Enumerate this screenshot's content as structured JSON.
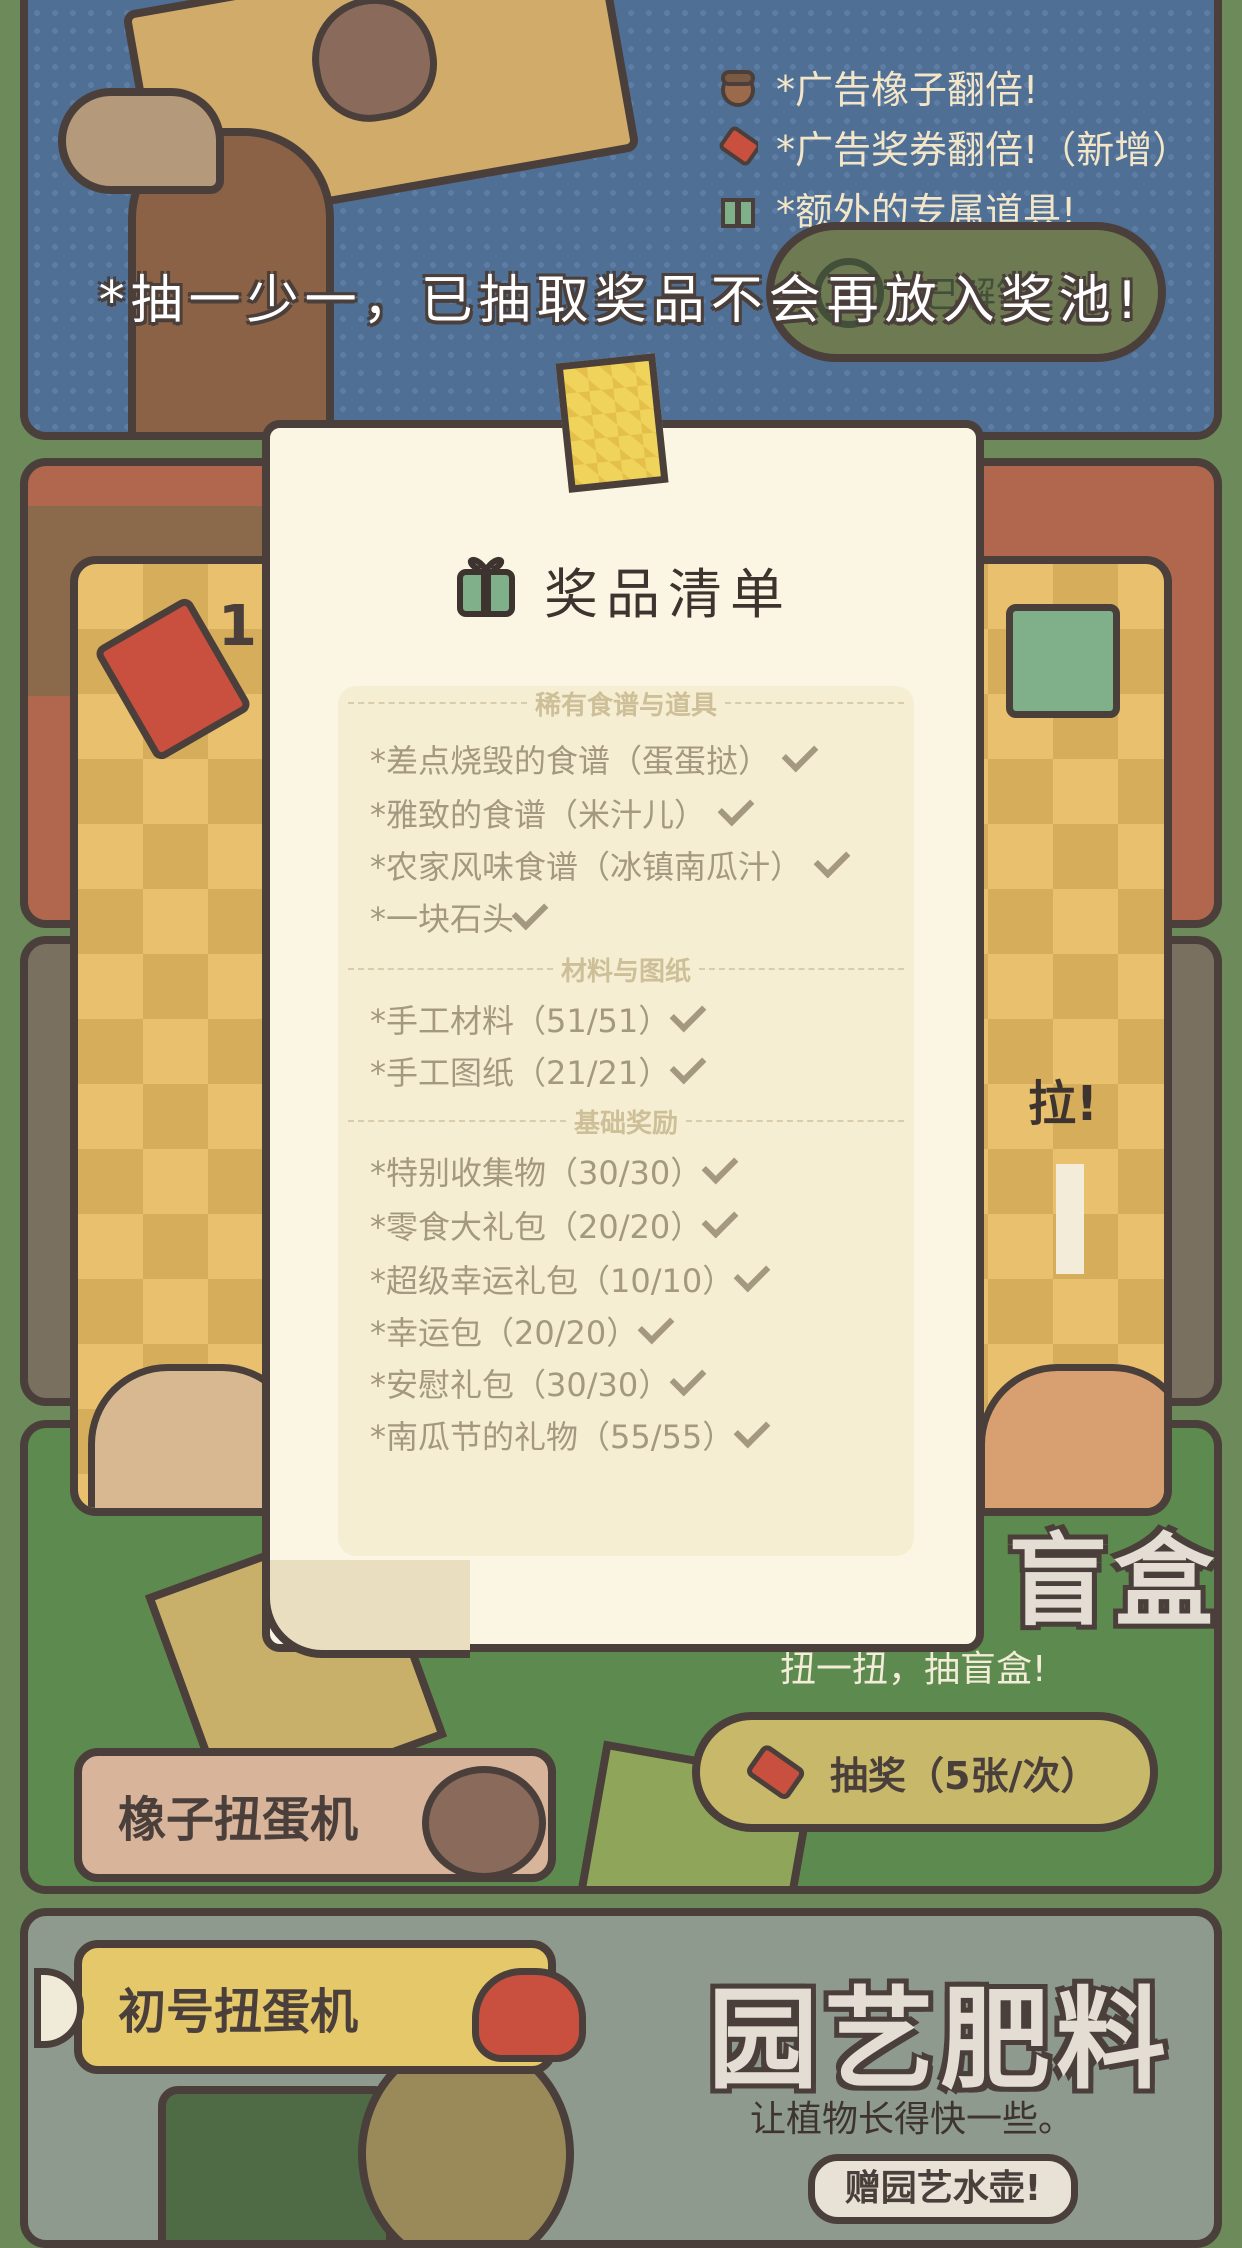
{
  "top_card": {
    "benefits": [
      {
        "icon": "acorn-icon",
        "label": "*广告橡子翻倍!"
      },
      {
        "icon": "ticket-icon",
        "label": "*广告奖券翻倍!（新增）"
      },
      {
        "icon": "gift-icon",
        "label": "*额外的专属道具!"
      }
    ],
    "unlocked_label": "已解锁",
    "banner": "*抽一少一，已抽取奖品不会再放入奖池!"
  },
  "machine": {
    "ticket_count": "1",
    "pull_label": "拉!"
  },
  "prize_list": {
    "title": "奖品清单",
    "sections": [
      {
        "header": "稀有食谱与道具",
        "items": [
          "*差点烧毁的食谱（蛋蛋挞）",
          "*雅致的食谱（米汁儿）",
          "*农家风味食谱（冰镇南瓜汁）",
          "*一块石头"
        ]
      },
      {
        "header": "材料与图纸",
        "items": [
          "*手工材料（51/51）",
          "*手工图纸（21/21）"
        ]
      },
      {
        "header": "基础奖励",
        "items": [
          "*特别收集物（30/30）",
          "*零食大礼包（20/20）",
          "*超级幸运礼包（10/10）",
          "*幸运包（20/20）",
          "*安慰礼包（30/30）",
          "*南瓜节的礼物（55/55）"
        ]
      }
    ]
  },
  "green_card": {
    "title_fragment": "盲盒",
    "subtitle": "扭一扭，抽盲盒!",
    "lottery_button": "抽奖（5张/次）",
    "machine_name": "橡子扭蛋机"
  },
  "bottom_card": {
    "machine_name": "初号扭蛋机",
    "title": "园艺肥料",
    "subtitle": "让植物长得快一些。",
    "gift_label": "赠园艺水壶!"
  },
  "colors": {
    "outline": "#4a3f3a",
    "paper": "#fbf6e3",
    "blue_card": "#4f6f95",
    "green_card": "#5d8a4e"
  }
}
